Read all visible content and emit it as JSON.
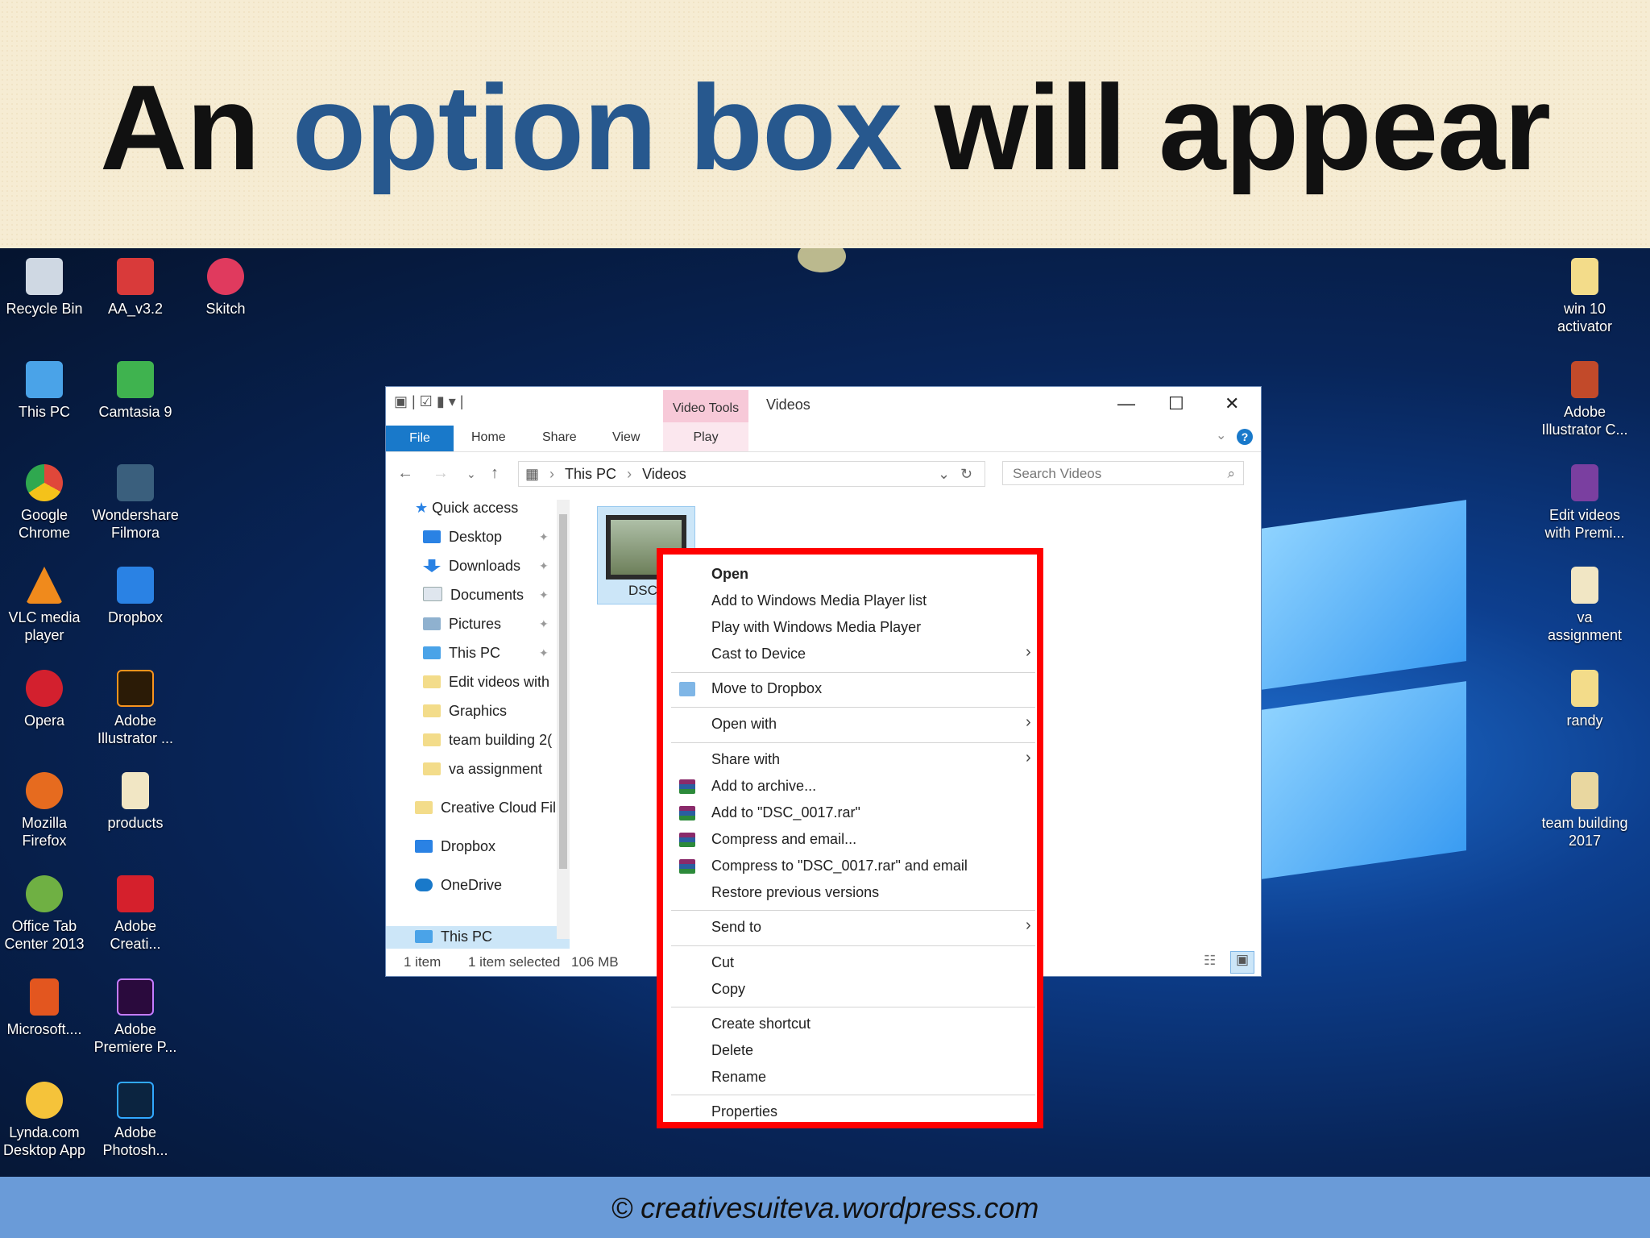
{
  "slide": {
    "title_part1": "An ",
    "title_accent": "option box",
    "title_part2": " will appear",
    "footer": "© creativesuiteva.wordpress.com"
  },
  "desktop": {
    "left_icons": [
      {
        "label": "Recycle Bin",
        "icon": "recycle-bin-icon",
        "color": "#cfd8e3"
      },
      {
        "label": "AA_v3.2",
        "icon": "aa-icon",
        "color": "#d93a3a"
      },
      {
        "label": "Skitch",
        "icon": "skitch-icon",
        "color": "#e03a5e"
      },
      {
        "label": "This PC",
        "icon": "computer-icon",
        "color": "#4aa3e8"
      },
      {
        "label": "Camtasia 9",
        "icon": "camtasia-icon",
        "color": "#3fb34f"
      },
      {
        "label": "Google Chrome",
        "icon": "chrome-icon",
        "color": "#e0473a"
      },
      {
        "label": "Wondershare Filmora",
        "icon": "filmora-icon",
        "color": "#3a5f7d"
      },
      {
        "label": "VLC media player",
        "icon": "vlc-icon",
        "color": "#f08a1c"
      },
      {
        "label": "Dropbox",
        "icon": "dropbox-icon",
        "color": "#2a82e4"
      },
      {
        "label": "Opera",
        "icon": "opera-icon",
        "color": "#d3202e"
      },
      {
        "label": "Adobe Illustrator ...",
        "icon": "illustrator-icon",
        "color": "#2b1b06"
      },
      {
        "label": "Mozilla Firefox",
        "icon": "firefox-icon",
        "color": "#e66b1f"
      },
      {
        "label": "products",
        "icon": "document-icon",
        "color": "#f1e6c4"
      },
      {
        "label": "Office Tab Center 2013",
        "icon": "office-tab-icon",
        "color": "#6fb043"
      },
      {
        "label": "Adobe Creati...",
        "icon": "creative-cloud-icon",
        "color": "#d5202c"
      },
      {
        "label": "Microsoft....",
        "icon": "office-icon",
        "color": "#e3561f"
      },
      {
        "label": "Adobe Premiere P...",
        "icon": "premiere-icon",
        "color": "#2a0a3d"
      },
      {
        "label": "Lynda.com Desktop App",
        "icon": "lynda-icon",
        "color": "#f5c33a"
      },
      {
        "label": "Adobe Photosh...",
        "icon": "photoshop-icon",
        "color": "#0b2440"
      }
    ],
    "right_icons": [
      {
        "label": "win 10 activator",
        "icon": "folder-icon",
        "color": "#f3dc8a"
      },
      {
        "label": "Adobe Illustrator C...",
        "icon": "book-icon",
        "color": "#c24a2a"
      },
      {
        "label": "Edit videos with Premi...",
        "icon": "book-icon",
        "color": "#7a3fa0"
      },
      {
        "label": "va assignment",
        "icon": "document-icon",
        "color": "#f1e6c4"
      },
      {
        "label": "randy",
        "icon": "folder-icon",
        "color": "#f3dc8a"
      },
      {
        "label": "team building 2017",
        "icon": "folder-icon",
        "color": "#e9d7a0"
      }
    ]
  },
  "explorer": {
    "context_tab": "Video Tools",
    "window_title": "Videos",
    "ribbon_tabs": {
      "file": "File",
      "home": "Home",
      "share": "Share",
      "view": "View",
      "play": "Play"
    },
    "breadcrumb": {
      "root": "This PC",
      "current": "Videos"
    },
    "search_placeholder": "Search Videos",
    "nav": {
      "quick_access": "Quick access",
      "desktop": "Desktop",
      "downloads": "Downloads",
      "documents": "Documents",
      "pictures": "Pictures",
      "this_pc_pinned": "This PC",
      "edit_videos": "Edit videos with",
      "graphics": "Graphics",
      "team_building": "team building 2(",
      "va_assignment": "va assignment",
      "creative_cloud": "Creative Cloud Fil",
      "dropbox": "Dropbox",
      "onedrive": "OneDrive",
      "this_pc": "This PC"
    },
    "file_name": "DSC",
    "status": {
      "items": "1 item",
      "selected": "1 item selected",
      "size": "106 MB"
    }
  },
  "context_menu": {
    "open": "Open",
    "add_wmp_list": "Add to Windows Media Player list",
    "play_wmp": "Play with Windows Media Player",
    "cast": "Cast to Device",
    "move_dropbox": "Move to Dropbox",
    "open_with": "Open with",
    "share_with": "Share with",
    "add_archive": "Add to archive...",
    "add_rar": "Add to \"DSC_0017.rar\"",
    "compress_email": "Compress and email...",
    "compress_rar_email": "Compress to \"DSC_0017.rar\" and email",
    "restore": "Restore previous versions",
    "send_to": "Send to",
    "cut": "Cut",
    "copy": "Copy",
    "create_shortcut": "Create shortcut",
    "delete": "Delete",
    "rename": "Rename",
    "properties": "Properties"
  },
  "colors": {
    "highlight_border": "#ff0000",
    "accent": "#27588e",
    "file_tab": "#1979ca"
  }
}
